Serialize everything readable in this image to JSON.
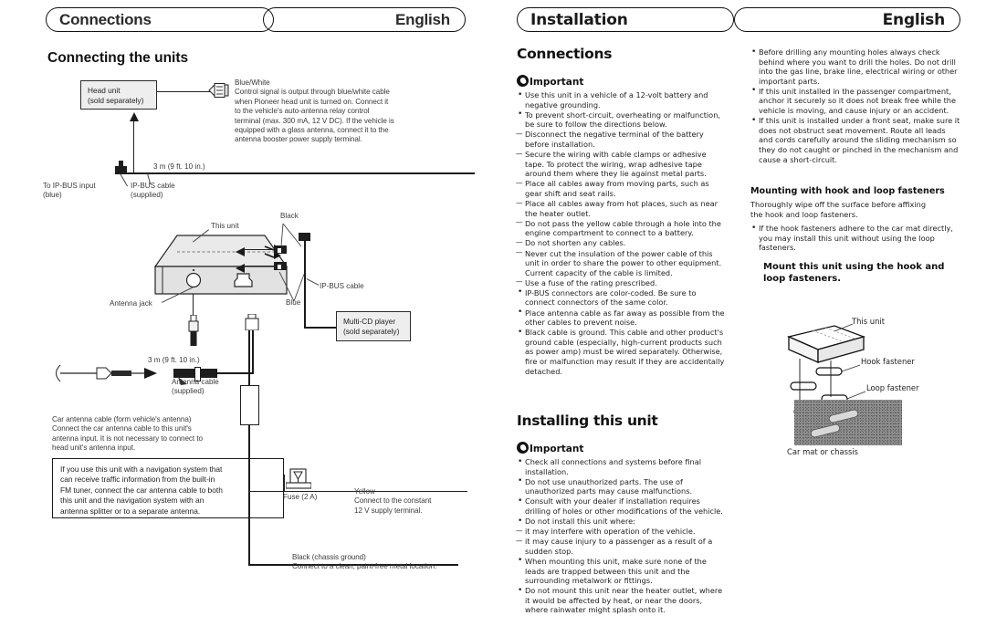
{
  "left_page": {
    "header": {
      "section": "Connections",
      "language": "English"
    },
    "title": "Connecting the units",
    "diagram": {
      "head_unit": "Head unit\n(sold separately)",
      "multicd": "Multi-CD player\n(sold separately)",
      "this_unit": "This unit",
      "antenna_jack": "Antenna jack",
      "to_ipbus_input": "To IP-BUS input\n(blue)",
      "ipbus_cable_supplied": "IP-BUS cable\n(supplied)",
      "ipbus_cable": "IP-BUS cable",
      "length_top": "3 m (9 ft. 10 in.)",
      "length_bottom": "3 m (9 ft. 10 in.)",
      "antenna_cable_supplied": "Antenna cable\n(supplied)",
      "black_label": "Black",
      "blue_label": "Blue",
      "fuse": "Fuse (2 A)",
      "yellow_note": "Yellow\nConnect to the constant\n12 V supply terminal.",
      "black_note": "Black (chassis ground)\nConnect to a clean, paint-free metal location.",
      "bluewhite_note": "Blue/White\nControl signal is output through blue/white cable\nwhen Pioneer head unit is turned on. Connect it\nto the vehicle's auto-antenna relay control\nterminal (max. 300 mA, 12 V DC). If the vehicle is\nequipped with a glass antenna, connect it to the\nantenna booster power supply terminal.",
      "car_antenna_note": "Car antenna cable (form vehicle's antenna)\nConnect the car antenna cable to this unit's\nantenna input. It is not necessary to connect to\nhead unit's antenna input.",
      "nav_box": "If you use this unit with a navigation system that\ncan receive traffic information from the built-in\nFM tuner, connect the car antenna cable to both\nthis unit and the navigation system with an\nantenna splitter or to a separate antenna."
    }
  },
  "right_page": {
    "header": {
      "section": "Installation",
      "language": "English"
    },
    "connections": {
      "title": "Connections",
      "important_label": "Important",
      "items": [
        {
          "type": "bullet",
          "text": "Use this unit in a vehicle of a 12-volt battery and negative grounding."
        },
        {
          "type": "bullet",
          "text": "To prevent short-circuit, overheating or malfunction, be sure to follow the directions below."
        },
        {
          "type": "dash",
          "text": "Disconnect the negative terminal of the battery before installation."
        },
        {
          "type": "dash",
          "text": "Secure the wiring with cable clamps or adhesive tape. To protect the wiring, wrap adhesive tape around them where they lie against metal parts."
        },
        {
          "type": "dash",
          "text": "Place all cables away from moving parts, such as gear shift and seat rails."
        },
        {
          "type": "dash",
          "text": "Place all cables away from hot places, such as near the heater outlet."
        },
        {
          "type": "dash",
          "text": "Do not pass the yellow cable through a hole into the engine compartment to connect to a battery."
        },
        {
          "type": "dash",
          "text": "Do not shorten any cables."
        },
        {
          "type": "dash",
          "text": "Never cut the insulation of the power cable of this unit in order to share the power to other equipment. Current capacity of the cable is limited."
        },
        {
          "type": "dash",
          "text": "Use a fuse of the rating prescribed."
        },
        {
          "type": "bullet",
          "text": "IP-BUS connectors are color-coded. Be sure to connect connectors of the same color."
        },
        {
          "type": "bullet",
          "text": "Place antenna cable as far away as possible from the other cables to prevent noise."
        },
        {
          "type": "bullet",
          "text": "Black cable is ground. This cable and other product's ground cable (especially, high-current products such as power amp) must be wired separately. Otherwise, fire or malfunction may result if they are accidentally detached."
        }
      ]
    },
    "installing": {
      "title": "Installing this unit",
      "important_label": "Important",
      "items": [
        {
          "type": "bullet",
          "text": "Check all connections and systems before final installation."
        },
        {
          "type": "bullet",
          "text": "Do not use unauthorized parts. The use of unauthorized parts may cause malfunctions."
        },
        {
          "type": "bullet",
          "text": "Consult with your dealer if installation requires drilling of holes or other modifications of the vehicle."
        },
        {
          "type": "bullet",
          "text": "Do not install this unit where:"
        },
        {
          "type": "dash",
          "text": "it may interfere with operation of the vehicle."
        },
        {
          "type": "dash",
          "text": "it may cause injury to a passenger as a result of a sudden stop."
        },
        {
          "type": "bullet",
          "text": "When mounting this unit, make sure none of the leads are trapped between this unit and the surrounding metalwork or fittings."
        },
        {
          "type": "bullet",
          "text": "Do not mount this unit near the heater outlet, where it would be affected by heat, or near the doors, where rainwater might splash onto it."
        }
      ]
    },
    "column3": {
      "items": [
        {
          "type": "bullet",
          "text": "Before drilling any mounting holes always check behind where you want to drill the holes. Do not drill into the gas line, brake line, electrical wiring or other important parts."
        },
        {
          "type": "bullet",
          "text": "If this unit installed in the passenger compartment, anchor it securely so it does not break free while the vehicle is moving, and cause injury or an accident."
        },
        {
          "type": "bullet",
          "text": "If this unit is installed under a front seat, make sure it does not obstruct seat movement. Route all leads and cords carefully around the sliding mechanism so they do not caught or pinched in the mechanism and cause a short-circuit."
        }
      ],
      "hook_heading": "Mounting with hook and loop fasteners",
      "hook_body": "Thoroughly wipe off the surface before affixing\nthe hook and loop fasteners.",
      "hook_bullet": "If the hook fasteners adhere to the car mat directly, you may install this unit without using the loop fasteners.",
      "mount_heading": "Mount this unit using the hook and\nloop fasteners.",
      "figure": {
        "this_unit": "This unit",
        "hook_fastener": "Hook fastener",
        "loop_fastener": "Loop fastener",
        "car_mat": "Car mat or chassis"
      }
    }
  }
}
